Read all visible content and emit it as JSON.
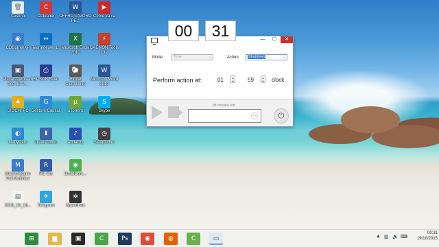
{
  "desktop": {
    "icons": [
      {
        "name": "recycle-bin-icon",
        "label": "Cestino",
        "color": "#e8eef4",
        "glyph": "🗑"
      },
      {
        "name": "ccleaner-icon",
        "label": "CCleaner",
        "color": "#d33",
        "glyph": "C"
      },
      {
        "name": "word-icon",
        "label": "OFFRO LAVORO PE...",
        "color": "#2b5797",
        "glyph": "W"
      },
      {
        "name": "youtube-icon",
        "label": "Come va.va",
        "color": "#d62525",
        "glyph": "▶"
      },
      {
        "name": "cdburnerxp-icon",
        "label": "CDBurnerXP",
        "color": "#3a7dc9",
        "glyph": "◉"
      },
      {
        "name": "teamviewer-icon",
        "label": "TeamViewer 10",
        "color": "#0e6fc1",
        "glyph": "↔"
      },
      {
        "name": "excel-icon",
        "label": "Microsoft Excel 2010",
        "color": "#1f7244",
        "glyph": "X"
      },
      {
        "name": "daemon-tools-icon",
        "label": "DAEMON Tools Lite",
        "color": "#c8402c",
        "glyph": "⚡"
      },
      {
        "name": "visualizzatore-icon",
        "label": "Visualizzatore di foto 3D V...",
        "color": "#465a74",
        "glyph": "▣"
      },
      {
        "name": "epson-scan-icon",
        "label": "EPSON Scan",
        "color": "#2a3e8f",
        "glyph": "⎙"
      },
      {
        "name": "virtual-clonedrive-icon",
        "label": "Virtual CloneDrive",
        "color": "#5a5a5a",
        "glyph": "🐑"
      },
      {
        "name": "ms-word-icon",
        "label": "Microsoft Word 2010",
        "color": "#2b5797",
        "glyph": "W"
      },
      {
        "name": "giochi-pc-icon",
        "label": "GIOCHI PC",
        "color": "#e0b020",
        "glyph": "★"
      },
      {
        "name": "gestore-icon",
        "label": "Gestore Capitali",
        "color": "#2e8ad6",
        "glyph": "G"
      },
      {
        "name": "utorrent-icon",
        "label": "uTorrent",
        "color": "#6ea735",
        "glyph": "µ"
      },
      {
        "name": "skype-icon",
        "label": "Skype",
        "color": "#00aff0",
        "glyph": "S"
      },
      {
        "name": "manycam-icon",
        "label": "ManyCam",
        "color": "#2e8ad6",
        "glyph": "◐"
      },
      {
        "name": "install-studio-icon",
        "label": "Install-studio",
        "color": "#3e64a8",
        "glyph": "⬇"
      },
      {
        "name": "audacity-icon",
        "label": "Audacity",
        "color": "#2850b0",
        "glyph": "♪"
      },
      {
        "name": "sleep-timer-icon",
        "label": "SleepTimer",
        "color": "#444",
        "glyph": "◷"
      },
      {
        "name": "multivelodyne-icon",
        "label": "Multivelodyne Full Multimer",
        "color": "#3a7dc9",
        "glyph": "M"
      },
      {
        "name": "rc-icon",
        "label": "RC Cle",
        "color": "#2e5aa8",
        "glyph": "R"
      },
      {
        "name": "droidcam-icon",
        "label": "DroidCam...",
        "color": "#4caf50",
        "glyph": "◉"
      },
      {
        "name": "file-icon",
        "label": "2015_10_18...",
        "color": "#f4f4f4",
        "glyph": "▤"
      },
      {
        "name": "telegram-icon",
        "label": "Telegram",
        "color": "#2ca5e0",
        "glyph": "✈"
      },
      {
        "name": "speedfan-icon",
        "label": "SpeedFan",
        "color": "#333",
        "glyph": "✲"
      }
    ]
  },
  "timer": {
    "hours": "00",
    "minutes": "31"
  },
  "app": {
    "mode_label": "Mode:",
    "mode_value": "Time",
    "action_label": "Action:",
    "action_value": "Shutdown",
    "perform_label": "Perform action at:",
    "hour_value": "01",
    "minute_value": "59",
    "colon": ":",
    "clock_label": "clock",
    "remaining": "88 minutes left",
    "minimize": "—",
    "maximize": "☐",
    "close": "✕",
    "power_glyph": "⏻",
    "mini_glyph": "◷"
  },
  "taskbar": {
    "items": [
      {
        "name": "start-button",
        "glyph": "⊞",
        "color": "#2e8b3e"
      },
      {
        "name": "file-explorer-icon",
        "glyph": "▆",
        "color": "#e6b84a"
      },
      {
        "name": "media-icon",
        "glyph": "▣",
        "color": "#2a2a2a"
      },
      {
        "name": "camtasia-icon",
        "glyph": "C",
        "color": "#4aa54a"
      },
      {
        "name": "photoshop-icon",
        "glyph": "Ps",
        "color": "#1d3b5c"
      },
      {
        "name": "chrome-icon",
        "glyph": "◉",
        "color": "#dd4b39"
      },
      {
        "name": "firefox-icon",
        "glyph": "◍",
        "color": "#e66000"
      },
      {
        "name": "camtasia-recorder-icon",
        "glyph": "C",
        "color": "#6ab04c"
      },
      {
        "name": "shutdown-timer-taskbar-icon",
        "glyph": "▭",
        "color": "#555"
      }
    ],
    "time": "00:31",
    "date": "19/10/2015"
  }
}
